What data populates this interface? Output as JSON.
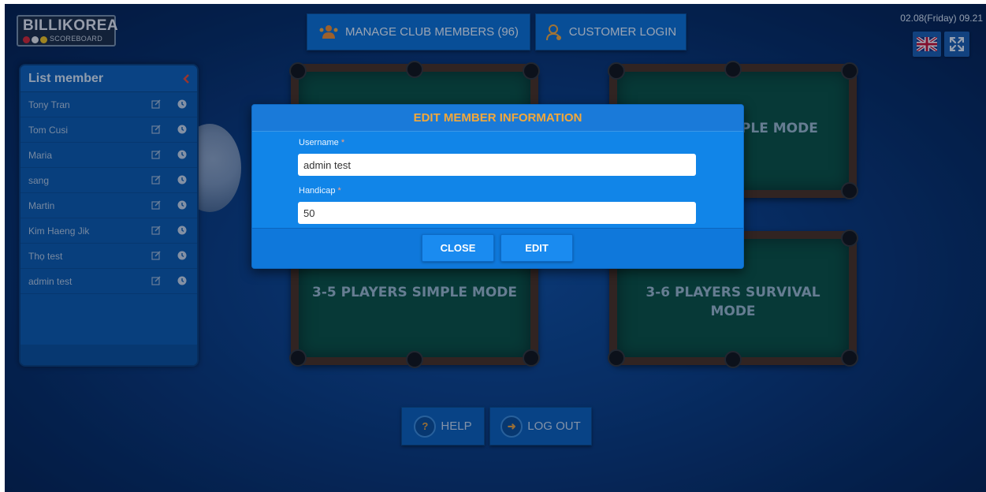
{
  "header": {
    "logo_title": "BILLIKOREA",
    "logo_sub": "SCOREBOARD",
    "manage_label": "MANAGE CLUB MEMBERS (96)",
    "login_label": "CUSTOMER LOGIN",
    "datetime": "02.08(Friday) 09.21"
  },
  "member_list": {
    "title": "List member",
    "members": [
      "Tony Tran",
      "Tom Cusi",
      "Maria",
      "sang",
      "Martin",
      "Kim Haeng Jik",
      "Thọ test",
      "admin test"
    ]
  },
  "tables": {
    "top_right_partial": "MPLE MODE",
    "bottom_left": "3-5 PLAYERS SIMPLE MODE",
    "bottom_right_line1": "3-6 PLAYERS SURVIVAL",
    "bottom_right_line2": "MODE"
  },
  "footer": {
    "help_label": "HELP",
    "logout_label": "LOG OUT"
  },
  "modal": {
    "title": "EDIT MEMBER INFORMATION",
    "username_label": "Username",
    "username_value": "admin test",
    "handicap_label": "Handicap",
    "handicap_value": "50",
    "required_mark": "*",
    "close_label": "CLOSE",
    "edit_label": "EDIT"
  },
  "colors": {
    "accent": "#f4a83a",
    "modal_bg": "#1185e8",
    "background": "#0a3b7e"
  }
}
